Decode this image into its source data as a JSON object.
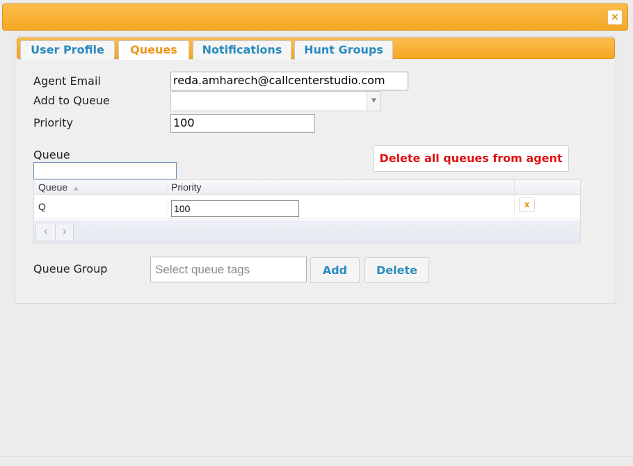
{
  "dialog": {
    "close_icon": "close-icon",
    "accent": "#f5a623"
  },
  "tabs": [
    {
      "label": "User Profile",
      "active": false
    },
    {
      "label": "Queues",
      "active": true
    },
    {
      "label": "Notifications",
      "active": false
    },
    {
      "label": "Hunt Groups",
      "active": false
    }
  ],
  "form": {
    "agent_email_label": "Agent Email",
    "agent_email_value": "reda.amharech@callcenterstudio.com",
    "add_to_queue_label": "Add to Queue",
    "add_to_queue_value": "",
    "priority_label": "Priority",
    "priority_value": "100",
    "queue_filter_label": "Queue",
    "queue_filter_value": ""
  },
  "delete_all_button": {
    "label": "Delete all queues from agent",
    "color": "#e01010"
  },
  "grid": {
    "columns": [
      "Queue",
      "Priority"
    ],
    "sort_icon": "sort-up-icon",
    "rows": [
      {
        "queue": "Q",
        "priority": "100",
        "delete_label": "x"
      }
    ],
    "pager": {
      "prev_icon": "chevron-left-icon",
      "next_icon": "chevron-right-icon"
    }
  },
  "queue_group": {
    "label": "Queue Group",
    "placeholder": "Select queue tags",
    "add_label": "Add",
    "delete_label": "Delete"
  }
}
